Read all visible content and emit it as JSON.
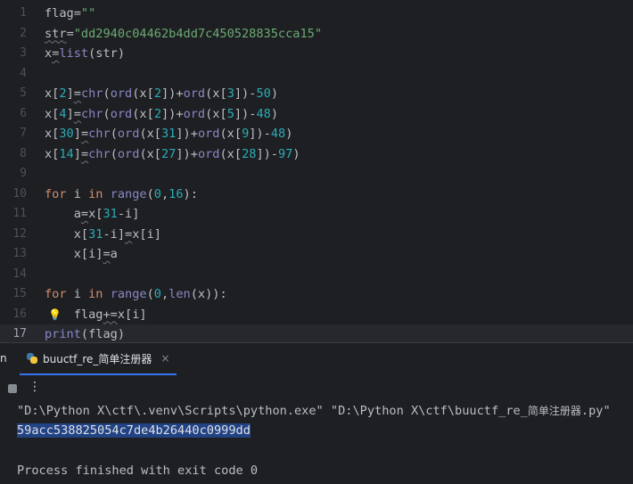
{
  "editor": {
    "current_line": "17",
    "lines": [
      {
        "num": "1",
        "tokens": [
          {
            "t": "flag=",
            "c": "plain"
          },
          {
            "t": "\"\"",
            "c": "str"
          }
        ]
      },
      {
        "num": "2",
        "tokens": [
          {
            "t": "str",
            "c": "plain",
            "u": true
          },
          {
            "t": "=",
            "c": "plain"
          },
          {
            "t": "\"dd2940c04462b4dd7c450528835cca15\"",
            "c": "str"
          }
        ]
      },
      {
        "num": "3",
        "tokens": [
          {
            "t": "x",
            "c": "plain"
          },
          {
            "t": "=",
            "c": "plain",
            "u": true
          },
          {
            "t": "list",
            "c": "bi"
          },
          {
            "t": "(str)",
            "c": "plain"
          }
        ]
      },
      {
        "num": "4",
        "tokens": []
      },
      {
        "num": "5",
        "tokens": [
          {
            "t": "x[",
            "c": "plain"
          },
          {
            "t": "2",
            "c": "num"
          },
          {
            "t": "]",
            "c": "plain"
          },
          {
            "t": "=",
            "c": "plain",
            "u": true
          },
          {
            "t": "chr",
            "c": "bi"
          },
          {
            "t": "(",
            "c": "plain"
          },
          {
            "t": "ord",
            "c": "bi"
          },
          {
            "t": "(x[",
            "c": "plain"
          },
          {
            "t": "2",
            "c": "num"
          },
          {
            "t": "])+",
            "c": "plain"
          },
          {
            "t": "ord",
            "c": "bi"
          },
          {
            "t": "(x[",
            "c": "plain"
          },
          {
            "t": "3",
            "c": "num"
          },
          {
            "t": "])-",
            "c": "plain"
          },
          {
            "t": "50",
            "c": "num"
          },
          {
            "t": ")",
            "c": "plain"
          }
        ]
      },
      {
        "num": "6",
        "tokens": [
          {
            "t": "x[",
            "c": "plain"
          },
          {
            "t": "4",
            "c": "num"
          },
          {
            "t": "]",
            "c": "plain"
          },
          {
            "t": "=",
            "c": "plain",
            "u": true
          },
          {
            "t": "chr",
            "c": "bi"
          },
          {
            "t": "(",
            "c": "plain"
          },
          {
            "t": "ord",
            "c": "bi"
          },
          {
            "t": "(x[",
            "c": "plain"
          },
          {
            "t": "2",
            "c": "num"
          },
          {
            "t": "])+",
            "c": "plain"
          },
          {
            "t": "ord",
            "c": "bi"
          },
          {
            "t": "(x[",
            "c": "plain"
          },
          {
            "t": "5",
            "c": "num"
          },
          {
            "t": "])-",
            "c": "plain"
          },
          {
            "t": "48",
            "c": "num"
          },
          {
            "t": ")",
            "c": "plain"
          }
        ]
      },
      {
        "num": "7",
        "tokens": [
          {
            "t": "x[",
            "c": "plain"
          },
          {
            "t": "30",
            "c": "num"
          },
          {
            "t": "]",
            "c": "plain"
          },
          {
            "t": "=",
            "c": "plain",
            "u": true
          },
          {
            "t": "chr",
            "c": "bi"
          },
          {
            "t": "(",
            "c": "plain"
          },
          {
            "t": "ord",
            "c": "bi"
          },
          {
            "t": "(x[",
            "c": "plain"
          },
          {
            "t": "31",
            "c": "num"
          },
          {
            "t": "])+",
            "c": "plain"
          },
          {
            "t": "ord",
            "c": "bi"
          },
          {
            "t": "(x[",
            "c": "plain"
          },
          {
            "t": "9",
            "c": "num"
          },
          {
            "t": "])-",
            "c": "plain"
          },
          {
            "t": "48",
            "c": "num"
          },
          {
            "t": ")",
            "c": "plain"
          }
        ]
      },
      {
        "num": "8",
        "tokens": [
          {
            "t": "x[",
            "c": "plain"
          },
          {
            "t": "14",
            "c": "num"
          },
          {
            "t": "]",
            "c": "plain"
          },
          {
            "t": "=",
            "c": "plain",
            "u": true
          },
          {
            "t": "chr",
            "c": "bi"
          },
          {
            "t": "(",
            "c": "plain"
          },
          {
            "t": "ord",
            "c": "bi"
          },
          {
            "t": "(x[",
            "c": "plain"
          },
          {
            "t": "27",
            "c": "num"
          },
          {
            "t": "])+",
            "c": "plain"
          },
          {
            "t": "ord",
            "c": "bi"
          },
          {
            "t": "(x[",
            "c": "plain"
          },
          {
            "t": "28",
            "c": "num"
          },
          {
            "t": "])-",
            "c": "plain"
          },
          {
            "t": "97",
            "c": "num"
          },
          {
            "t": ")",
            "c": "plain"
          }
        ]
      },
      {
        "num": "9",
        "tokens": []
      },
      {
        "num": "10",
        "tokens": [
          {
            "t": "for",
            "c": "kw"
          },
          {
            "t": " i ",
            "c": "plain"
          },
          {
            "t": "in",
            "c": "kw"
          },
          {
            "t": " ",
            "c": "plain"
          },
          {
            "t": "range",
            "c": "bi"
          },
          {
            "t": "(",
            "c": "plain"
          },
          {
            "t": "0",
            "c": "num"
          },
          {
            "t": ",",
            "c": "plain"
          },
          {
            "t": "16",
            "c": "num"
          },
          {
            "t": "):",
            "c": "plain"
          }
        ]
      },
      {
        "num": "11",
        "tokens": [
          {
            "t": "    a",
            "c": "plain"
          },
          {
            "t": "=",
            "c": "plain",
            "u": true
          },
          {
            "t": "x[",
            "c": "plain"
          },
          {
            "t": "31",
            "c": "num"
          },
          {
            "t": "-i]",
            "c": "plain"
          }
        ]
      },
      {
        "num": "12",
        "tokens": [
          {
            "t": "    x[",
            "c": "plain"
          },
          {
            "t": "31",
            "c": "num"
          },
          {
            "t": "-i]",
            "c": "plain"
          },
          {
            "t": "=",
            "c": "plain",
            "u": true
          },
          {
            "t": "x[i]",
            "c": "plain"
          }
        ]
      },
      {
        "num": "13",
        "tokens": [
          {
            "t": "    x[i]",
            "c": "plain"
          },
          {
            "t": "=",
            "c": "plain",
            "u": true
          },
          {
            "t": "a",
            "c": "plain"
          }
        ]
      },
      {
        "num": "14",
        "tokens": []
      },
      {
        "num": "15",
        "tokens": [
          {
            "t": "for",
            "c": "kw"
          },
          {
            "t": " i ",
            "c": "plain"
          },
          {
            "t": "in",
            "c": "kw"
          },
          {
            "t": " ",
            "c": "plain"
          },
          {
            "t": "range",
            "c": "bi"
          },
          {
            "t": "(",
            "c": "plain"
          },
          {
            "t": "0",
            "c": "num"
          },
          {
            "t": ",",
            "c": "plain"
          },
          {
            "t": "len",
            "c": "bi"
          },
          {
            "t": "(x)):",
            "c": "plain"
          }
        ]
      },
      {
        "num": "16",
        "bulb": true,
        "tokens": [
          {
            "t": "    flag",
            "c": "plain"
          },
          {
            "t": "+=",
            "c": "plain",
            "u": true
          },
          {
            "t": "x[i]",
            "c": "plain"
          }
        ]
      },
      {
        "num": "17",
        "tokens": [
          {
            "t": "print",
            "c": "bi"
          },
          {
            "t": "(flag)",
            "c": "plain"
          }
        ]
      }
    ]
  },
  "tool_window": {
    "title_fragment": "n",
    "tab_label": "buuctf_re_简单注册器",
    "tab_close": "×",
    "more_glyph": "⋮"
  },
  "console": {
    "command_ascii": "\"D:\\Python X\\ctf\\.venv\\Scripts\\python.exe\" \"D:\\Python X\\ctf\\buuctf_re_",
    "command_cjk": "简单注册器",
    "command_tail": ".py\"",
    "output": "59acc538825054c7de4b26440c0999dd",
    "exit_message": "Process finished with exit code 0"
  },
  "colors": {
    "background": "#1e1f22",
    "string": "#6aab73",
    "number": "#2aacb8",
    "keyword": "#cf8e6d",
    "builtin": "#8888c6",
    "selection": "#214283",
    "tab_underline": "#3574f0"
  }
}
